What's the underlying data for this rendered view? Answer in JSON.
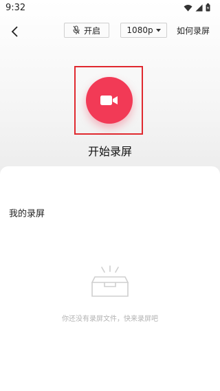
{
  "status_bar": {
    "time": "9:32"
  },
  "toolbar": {
    "mic_label": "开启",
    "resolution": "1080p",
    "howto_label": "如何录屏"
  },
  "record": {
    "label": "开始录屏"
  },
  "recordings": {
    "title": "我的录屏",
    "empty_text": "你还没有录屏文件，快来录屏吧"
  },
  "colors": {
    "accent": "#f23a56",
    "highlight_frame": "#e0282e"
  },
  "icons": [
    "wifi-icon",
    "signal-icon",
    "battery-icon",
    "back-arrow-icon",
    "mic-icon",
    "chevron-down-icon",
    "video-camera-icon",
    "empty-box-icon"
  ]
}
